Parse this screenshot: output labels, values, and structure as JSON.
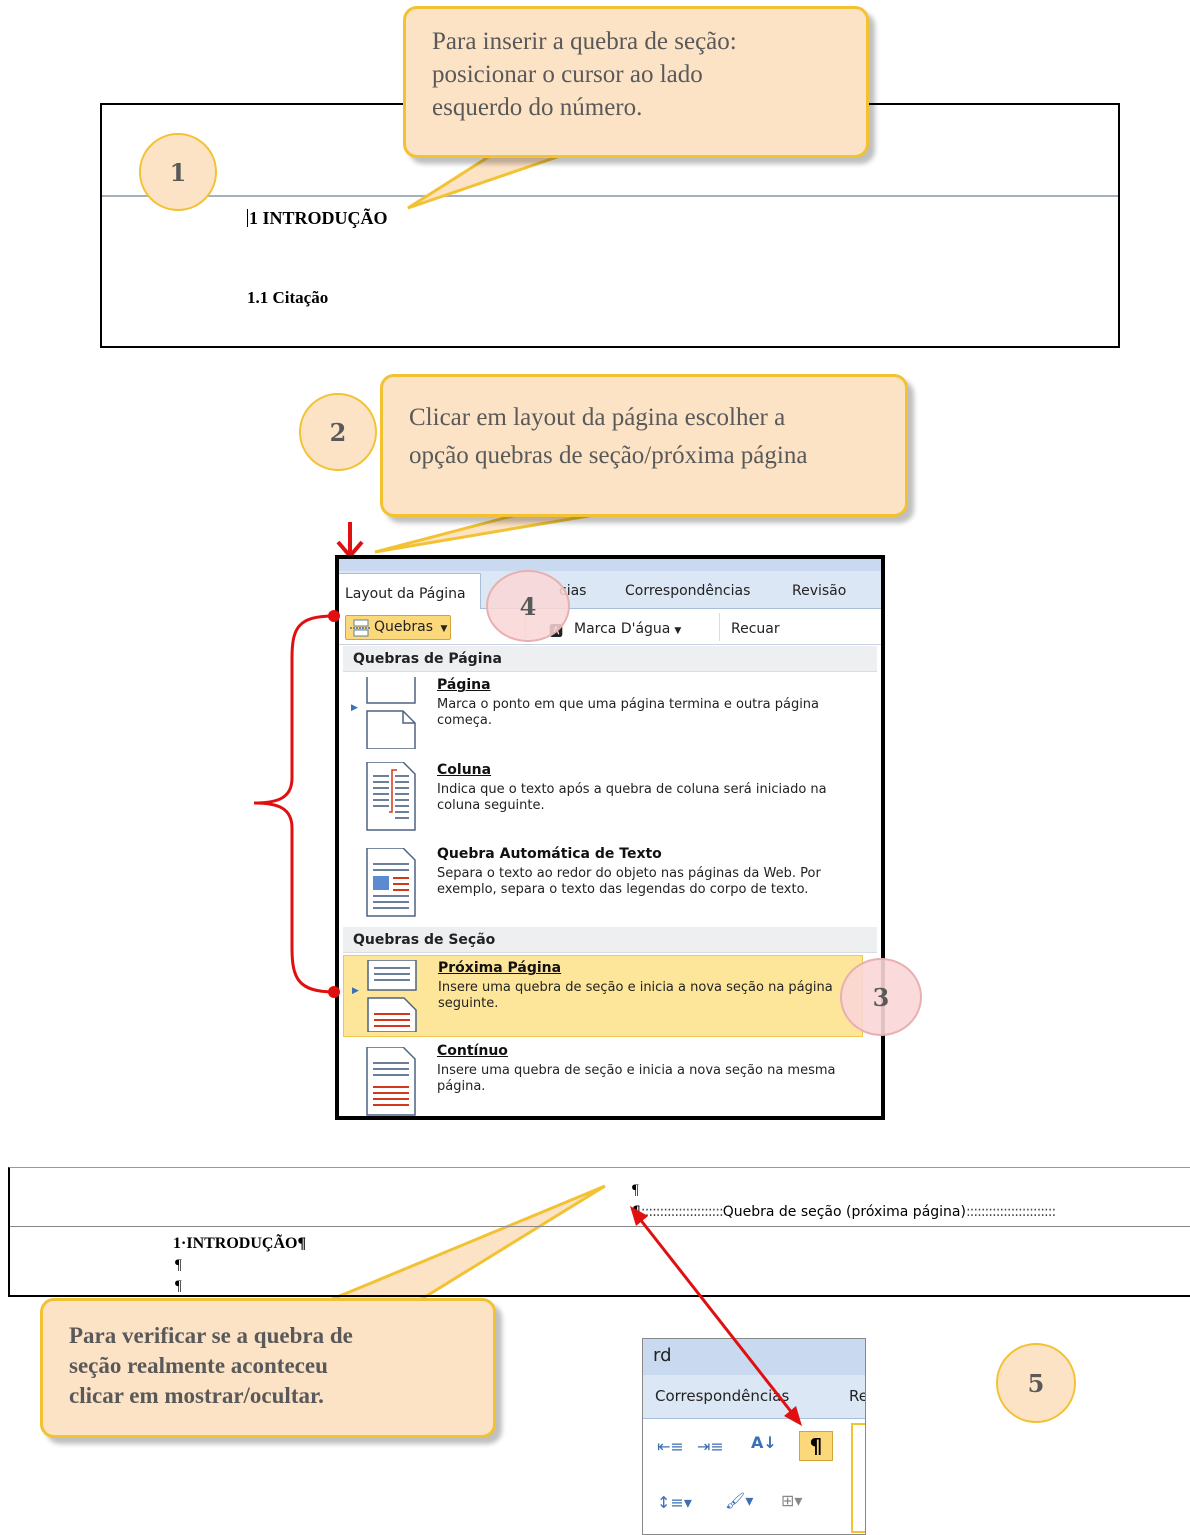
{
  "callouts": {
    "c1": [
      "Para inserir a quebra de seção:",
      "posicionar o cursor ao lado",
      "esquerdo do número."
    ],
    "c2": [
      "Clicar em layout da página escolher a",
      "opção quebras de seção/próxima página"
    ],
    "c3": [
      "Para verificar se a quebra de",
      "seção realmente aconteceu",
      "clicar em mostrar/ocultar."
    ]
  },
  "steps": {
    "s1": "1",
    "s2": "2",
    "s3": "3",
    "s4": "4",
    "s5": "5"
  },
  "doc1": {
    "heading": "1 INTRODUÇÃO",
    "subheading": "1.1 Citação"
  },
  "ribbon": {
    "tabs": {
      "active": "Layout da Página",
      "partial": "cias",
      "mail": "Correspondências",
      "review": "Revisão"
    },
    "toolbar": {
      "breaks": "Quebras",
      "watermark": "Marca D'água",
      "indent": "Recuar"
    }
  },
  "menu": {
    "page_breaks_header": "Quebras de Página",
    "section_breaks_header": "Quebras de Seção",
    "items": [
      {
        "title": "Página",
        "desc": "Marca o ponto em que uma página termina e outra página começa."
      },
      {
        "title": "Coluna",
        "desc": "Indica que o texto após a quebra de coluna será iniciado na coluna seguinte."
      },
      {
        "title": "Quebra Automática de Texto",
        "desc": "Separa o texto ao redor do objeto nas páginas da Web. Por exemplo, separa o texto das legendas do corpo de texto."
      },
      {
        "title": "Próxima Página",
        "desc": "Insere uma quebra de seção e inicia a nova seção na página seguinte."
      },
      {
        "title": "Contínuo",
        "desc": "Insere uma quebra de seção e inicia a nova seção na mesma página."
      }
    ]
  },
  "doc2": {
    "pilcrow": "¶",
    "section_break": "Quebra de seção (próxima página)",
    "heading": "1·INTRODUÇÃO¶"
  },
  "snap": {
    "title": "rd",
    "tab": "Correspondências",
    "tab_partial": "Re",
    "show_hide": "¶"
  },
  "colors": {
    "callout_fill": "#fde3c6",
    "callout_border": "#f2c232",
    "arrow_red": "#e01010",
    "highlight": "#fde69a"
  }
}
